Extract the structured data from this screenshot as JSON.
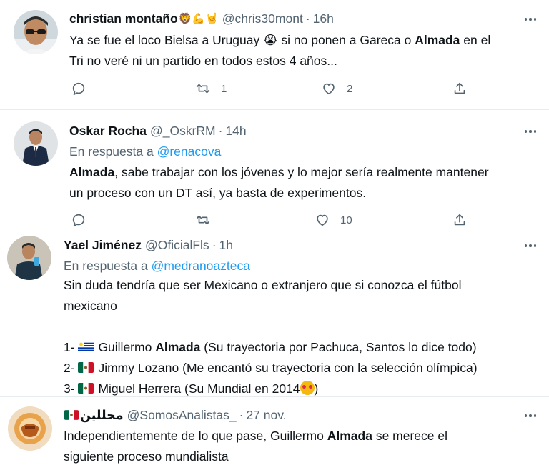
{
  "tweets": [
    {
      "name": "christian montaño",
      "name_emojis": "🦁💪🤘",
      "handle": "@chris30mont",
      "time": "16h",
      "body_lines": [
        [
          "Ya se fue el loco Bielsa a Uruguay ",
          "😭",
          " si no ponen a Gareca o ",
          "Almada",
          " en el"
        ],
        "Tri no veré ni un partido en todos estos 4 años..."
      ],
      "line1_pre": "Ya se fue el loco Bielsa a Uruguay ",
      "line1_emoji": "😭",
      "line1_mid": " si no ponen a Gareca o ",
      "line1_bold": "Almada",
      "line1_post": " en el",
      "line2": "Tri no veré ni un partido en todos estos 4 años...",
      "retweets": "1",
      "likes": "2"
    },
    {
      "name": "Oskar Rocha",
      "handle": "@_OskrRM",
      "time": "14h",
      "reply_prefix": "En respuesta a ",
      "reply_mention": "@renacova",
      "line1_bold": "Almada",
      "line1_post": ", sabe trabajar con los jóvenes y lo mejor sería realmente mantener",
      "line2": "un proceso con un DT así, ya basta de experimentos.",
      "retweets": "",
      "likes": "10"
    },
    {
      "name": "Yael Jiménez",
      "handle": "@OficialFls",
      "time": "1h",
      "reply_prefix": "En respuesta a ",
      "reply_mention": "@medranoazteca",
      "line1": "Sin duda tendría que ser Mexicano o extranjero que si conozca el fútbol",
      "line2": "mexicano",
      "list": [
        {
          "num": "1- ",
          "flag": "uruguay-flag",
          "pre": "Guillermo ",
          "bold": "Almada",
          "post": " (Su trayectoria por Pachuca, Santos lo dice todo)"
        },
        {
          "num": "2- ",
          "flag": "mexico-flag",
          "pre": "Jimmy Lozano (Me encantó su trayectoria con la selección olímpica)",
          "bold": "",
          "post": ""
        },
        {
          "num": "3- ",
          "flag": "mexico-flag",
          "pre": "Miguel Herrera (Su Mundial en 2014",
          "bold": "",
          "post": ")"
        }
      ]
    },
    {
      "name_flag": "mexico-flag",
      "name": "محللين",
      "handle": "@SomosAnalistas_",
      "time": "27 nov.",
      "line1_pre": "Independientemente de lo que pase, Guillermo ",
      "line1_bold": "Almada",
      "line1_post": " se merece el",
      "line2": "siguiente proceso mundialista"
    }
  ],
  "separator": "·",
  "icons": [
    "reply-icon",
    "retweet-icon",
    "like-icon",
    "share-icon",
    "more-icon"
  ],
  "colors": {
    "link": "#1d9bf0",
    "secondary": "#536471",
    "text": "#0f1419",
    "divider": "#e6ecf0"
  }
}
